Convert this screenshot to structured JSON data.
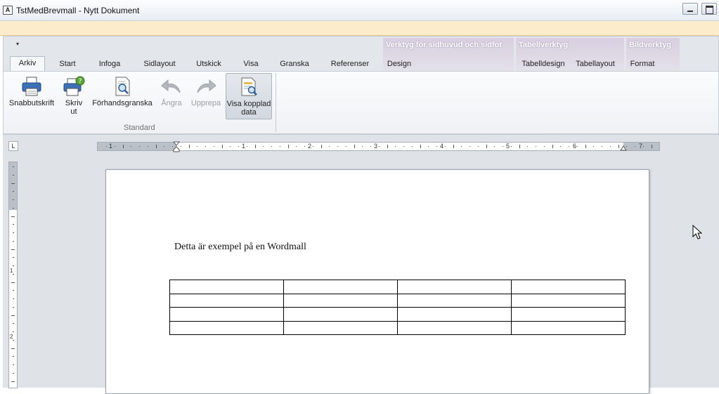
{
  "window": {
    "title": "TstMedBrevmall - Nytt Dokument",
    "app_icon_glyph": "A"
  },
  "ribbon": {
    "qat_glyph": "▾",
    "contextual_groups": [
      {
        "label": "Verktyg för sidhuvud och sidfot"
      },
      {
        "label": "Tabellverktyg"
      },
      {
        "label": "Bildverktyg"
      }
    ],
    "tabs": [
      "Arkiv",
      "Start",
      "Infoga",
      "Sidlayout",
      "Utskick",
      "Visa",
      "Granska",
      "Referenser",
      "Design",
      "Tabelldesign",
      "Tabellayout",
      "Format"
    ],
    "active_tab": "Arkiv",
    "buttons": {
      "snabbutskrift": "Snabbutskrift",
      "skriv_ut_line1": "Skriv",
      "skriv_ut_line2": "ut",
      "forhandsgranska": "Förhandsgranska",
      "angra": "Ångra",
      "upprepa": "Upprepa",
      "visa_kopplad_line1": "Visa kopplad",
      "visa_kopplad_line2": "data"
    },
    "group_label": "Standard"
  },
  "ruler": {
    "corner_glyph": "L",
    "horizontal_numbers": [
      "1",
      "1",
      "2",
      "3",
      "4",
      "5",
      "6",
      "7"
    ],
    "vertical_numbers": [
      "1",
      "2"
    ]
  },
  "document": {
    "text": "Detta är exempel på en Wordmall",
    "table": {
      "rows": 4,
      "cols": 4
    }
  },
  "colors": {
    "message_bar": "#fdeccc",
    "ribbon_bg": "#e3e6ea",
    "contextual_tab": "#d8cfe0",
    "doc_background": "#dfe3e8"
  }
}
